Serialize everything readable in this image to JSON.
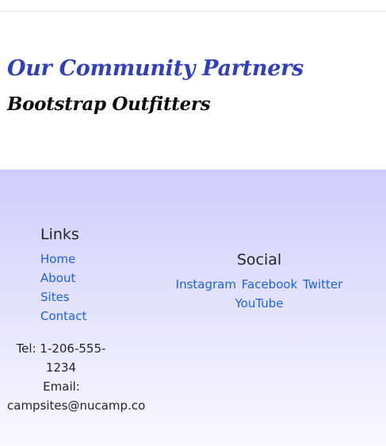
{
  "partners": {
    "heading": "Our Community Partners",
    "name": "Bootstrap Outfitters"
  },
  "footer": {
    "links": {
      "heading": "Links",
      "items": [
        "Home",
        "About",
        "Sites",
        "Contact"
      ]
    },
    "contact": {
      "tel_label": "Tel: 1-206-555-1234",
      "email_label": "Email:",
      "email_value": "campsites@nucamp.co"
    },
    "social": {
      "heading": "Social",
      "items": [
        "Instagram",
        "Facebook",
        "Twitter",
        "YouTube"
      ]
    }
  },
  "colors": {
    "partners_heading": "#2f3fbf",
    "link": "#1a63e8",
    "footer_top": "#d0ccfb",
    "footer_bottom": "#faf9ff"
  }
}
